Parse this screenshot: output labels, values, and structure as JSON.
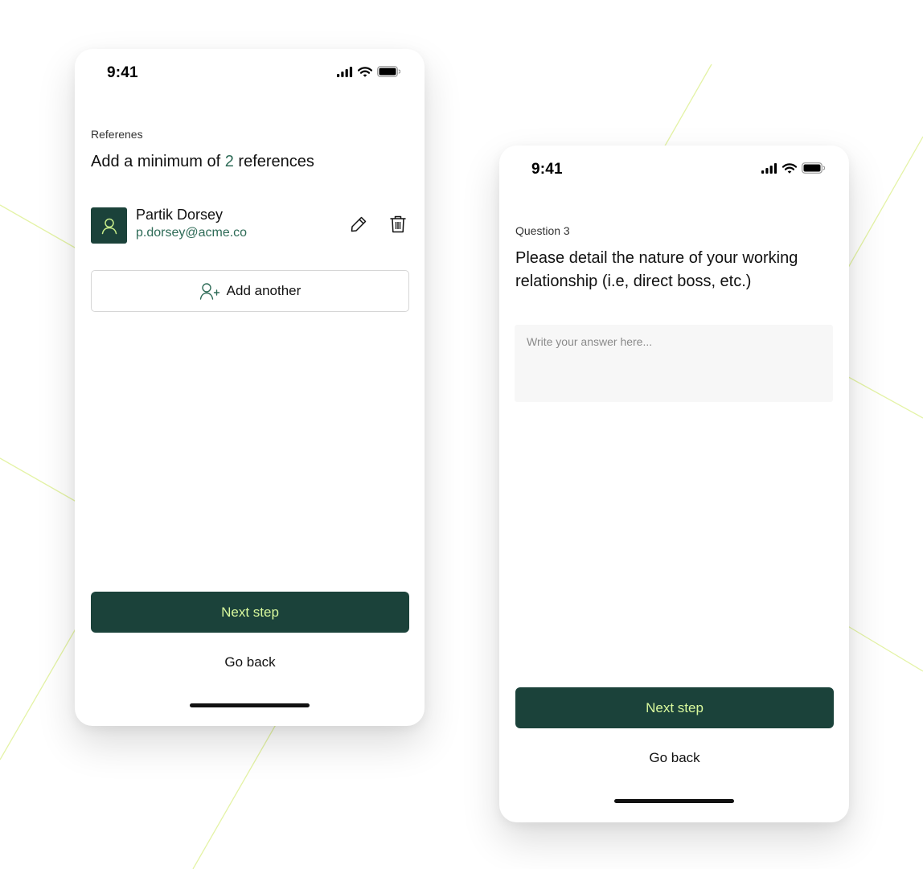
{
  "colors": {
    "brand_dark": "#1b423a",
    "accent_green": "#2e6b57",
    "button_text": "#d9f99d",
    "bg_line": "#e4f3a6"
  },
  "screen_references": {
    "status": {
      "time": "9:41",
      "icons": [
        "signal-icon",
        "wifi-icon",
        "battery-icon"
      ]
    },
    "eyebrow": "Referenes",
    "heading": {
      "prefix": "Add a minimum of",
      "count": "2",
      "suffix": "references"
    },
    "reference": {
      "name": "Partik Dorsey",
      "email": "p.dorsey@acme.co",
      "avatar_icon": "user-icon",
      "actions": [
        "pencil-icon",
        "trash-icon"
      ]
    },
    "add_button": {
      "label": "Add another",
      "icon": "user-plus-icon"
    },
    "next_label": "Next step",
    "back_label": "Go back"
  },
  "screen_question": {
    "status": {
      "time": "9:41",
      "icons": [
        "signal-icon",
        "wifi-icon",
        "battery-icon"
      ]
    },
    "eyebrow": "Question 3",
    "heading": "Please detail the nature of your working relationship (i.e, direct boss, etc.)",
    "answer": {
      "value": "",
      "placeholder": "Write your answer here..."
    },
    "next_label": "Next step",
    "back_label": "Go back"
  }
}
